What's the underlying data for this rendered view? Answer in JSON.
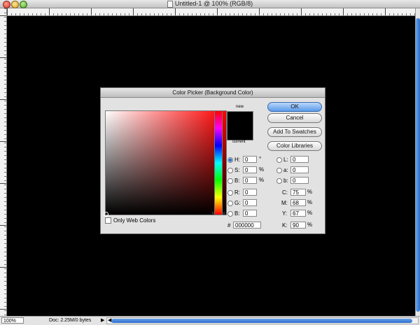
{
  "window": {
    "title": "Untitled-1 @ 100% (RGB/8)"
  },
  "status": {
    "zoom": "100%",
    "doc_info": "Doc: 2.25M/0 bytes"
  },
  "dialog": {
    "title": "Color Picker (Background Color)",
    "new_label": "new",
    "current_label": "current",
    "only_web_colors": "Only Web Colors",
    "buttons": {
      "ok": "OK",
      "cancel": "Cancel",
      "add_swatches": "Add To Swatches",
      "color_libraries": "Color Libraries"
    },
    "hsb": {
      "h": {
        "label": "H:",
        "value": "0",
        "unit": "°"
      },
      "s": {
        "label": "S:",
        "value": "0",
        "unit": "%"
      },
      "b": {
        "label": "B:",
        "value": "0",
        "unit": "%"
      }
    },
    "rgb": {
      "r": {
        "label": "R:",
        "value": "0"
      },
      "g": {
        "label": "G:",
        "value": "0"
      },
      "b": {
        "label": "B:",
        "value": "0"
      }
    },
    "lab": {
      "l": {
        "label": "L:",
        "value": "0"
      },
      "a": {
        "label": "a:",
        "value": "0"
      },
      "b": {
        "label": "b:",
        "value": "0"
      }
    },
    "cmyk": {
      "c": {
        "label": "C:",
        "value": "75",
        "unit": "%"
      },
      "m": {
        "label": "M:",
        "value": "68",
        "unit": "%"
      },
      "y": {
        "label": "Y:",
        "value": "67",
        "unit": "%"
      },
      "k": {
        "label": "K:",
        "value": "90",
        "unit": "%"
      }
    },
    "hex": {
      "label": "#",
      "value": "000000"
    },
    "colors": {
      "selected": "#000000",
      "hue_top": "#ff0000"
    }
  }
}
